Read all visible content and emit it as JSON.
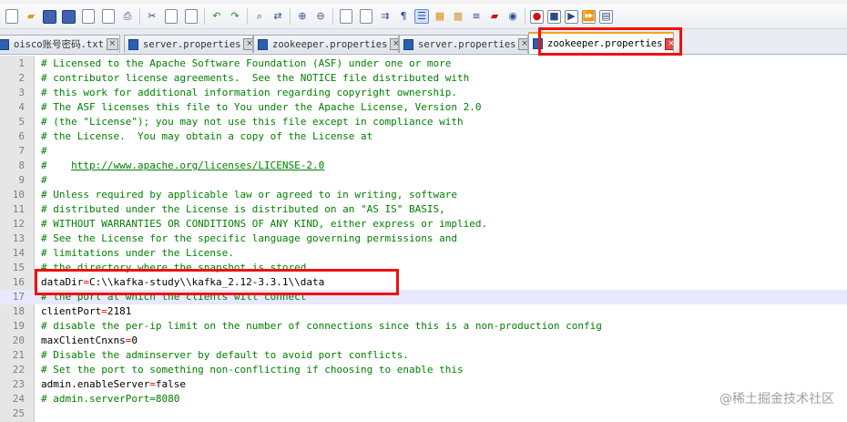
{
  "tabs": [
    {
      "label": "oisco账号密码.txt",
      "active": false
    },
    {
      "label": "server.properties",
      "active": false
    },
    {
      "label": "zookeeper.properties",
      "active": false
    },
    {
      "label": "server.properties",
      "active": false
    },
    {
      "label": "zookeeper.properties",
      "active": true
    }
  ],
  "toolbar_icons": [
    "new-file",
    "open-file",
    "save-file",
    "save-all",
    "close-file",
    "close-all",
    "print",
    "cut",
    "copy",
    "paste",
    "undo",
    "redo",
    "find",
    "replace",
    "zoom-in",
    "zoom-out",
    "sync-vertical",
    "sync-horizontal",
    "word-wrap",
    "show-all-chars",
    "indent-guide",
    "user-language",
    "doc-map",
    "function-list",
    "folder-workspace",
    "monitoring",
    "record-macro",
    "stop-macro",
    "play-macro",
    "run-macro-multiple",
    "save-macro"
  ],
  "editor": {
    "current_line": 17,
    "lines": [
      {
        "n": "1",
        "type": "comment",
        "text": "# Licensed to the Apache Software Foundation (ASF) under one or more"
      },
      {
        "n": "2",
        "type": "comment",
        "text": "# contributor license agreements.  See the NOTICE file distributed with"
      },
      {
        "n": "3",
        "type": "comment",
        "text": "# this work for additional information regarding copyright ownership."
      },
      {
        "n": "4",
        "type": "comment",
        "text": "# The ASF licenses this file to You under the Apache License, Version 2.0"
      },
      {
        "n": "5",
        "type": "comment",
        "text": "# (the \"License\"); you may not use this file except in compliance with"
      },
      {
        "n": "6",
        "type": "comment",
        "text": "# the License.  You may obtain a copy of the License at"
      },
      {
        "n": "7",
        "type": "comment",
        "text": "#"
      },
      {
        "n": "8",
        "type": "url",
        "prefix": "#    ",
        "text": "http://www.apache.org/licenses/LICENSE-2.0"
      },
      {
        "n": "9",
        "type": "comment",
        "text": "#"
      },
      {
        "n": "10",
        "type": "comment",
        "text": "# Unless required by applicable law or agreed to in writing, software"
      },
      {
        "n": "11",
        "type": "comment",
        "text": "# distributed under the License is distributed on an \"AS IS\" BASIS,"
      },
      {
        "n": "12",
        "type": "comment",
        "text": "# WITHOUT WARRANTIES OR CONDITIONS OF ANY KIND, either express or implied."
      },
      {
        "n": "13",
        "type": "comment",
        "text": "# See the License for the specific language governing permissions and"
      },
      {
        "n": "14",
        "type": "comment",
        "text": "# limitations under the License."
      },
      {
        "n": "15",
        "type": "comment",
        "text": "# the directory where the snapshot is stored."
      },
      {
        "n": "16",
        "type": "kv",
        "key": "dataDir",
        "eq": "=",
        "value": "C:\\\\kafka-study\\\\kafka_2.12-3.3.1\\\\data"
      },
      {
        "n": "17",
        "type": "comment",
        "text": "# the port at which the clients will connect"
      },
      {
        "n": "18",
        "type": "kv",
        "key": "clientPort",
        "eq": "=",
        "value": "2181"
      },
      {
        "n": "19",
        "type": "comment",
        "text": "# disable the per-ip limit on the number of connections since this is a non-production config"
      },
      {
        "n": "20",
        "type": "kv",
        "key": "maxClientCnxns",
        "eq": "=",
        "value": "0"
      },
      {
        "n": "21",
        "type": "comment",
        "text": "# Disable the adminserver by default to avoid port conflicts."
      },
      {
        "n": "22",
        "type": "comment",
        "text": "# Set the port to something non-conflicting if choosing to enable this"
      },
      {
        "n": "23",
        "type": "kv",
        "key": "admin.enableServer",
        "eq": "=",
        "value": "false"
      },
      {
        "n": "24",
        "type": "comment",
        "text": "# admin.serverPort=8080"
      },
      {
        "n": "25",
        "type": "empty",
        "text": ""
      }
    ]
  },
  "watermark": "@稀土掘金技术社区"
}
